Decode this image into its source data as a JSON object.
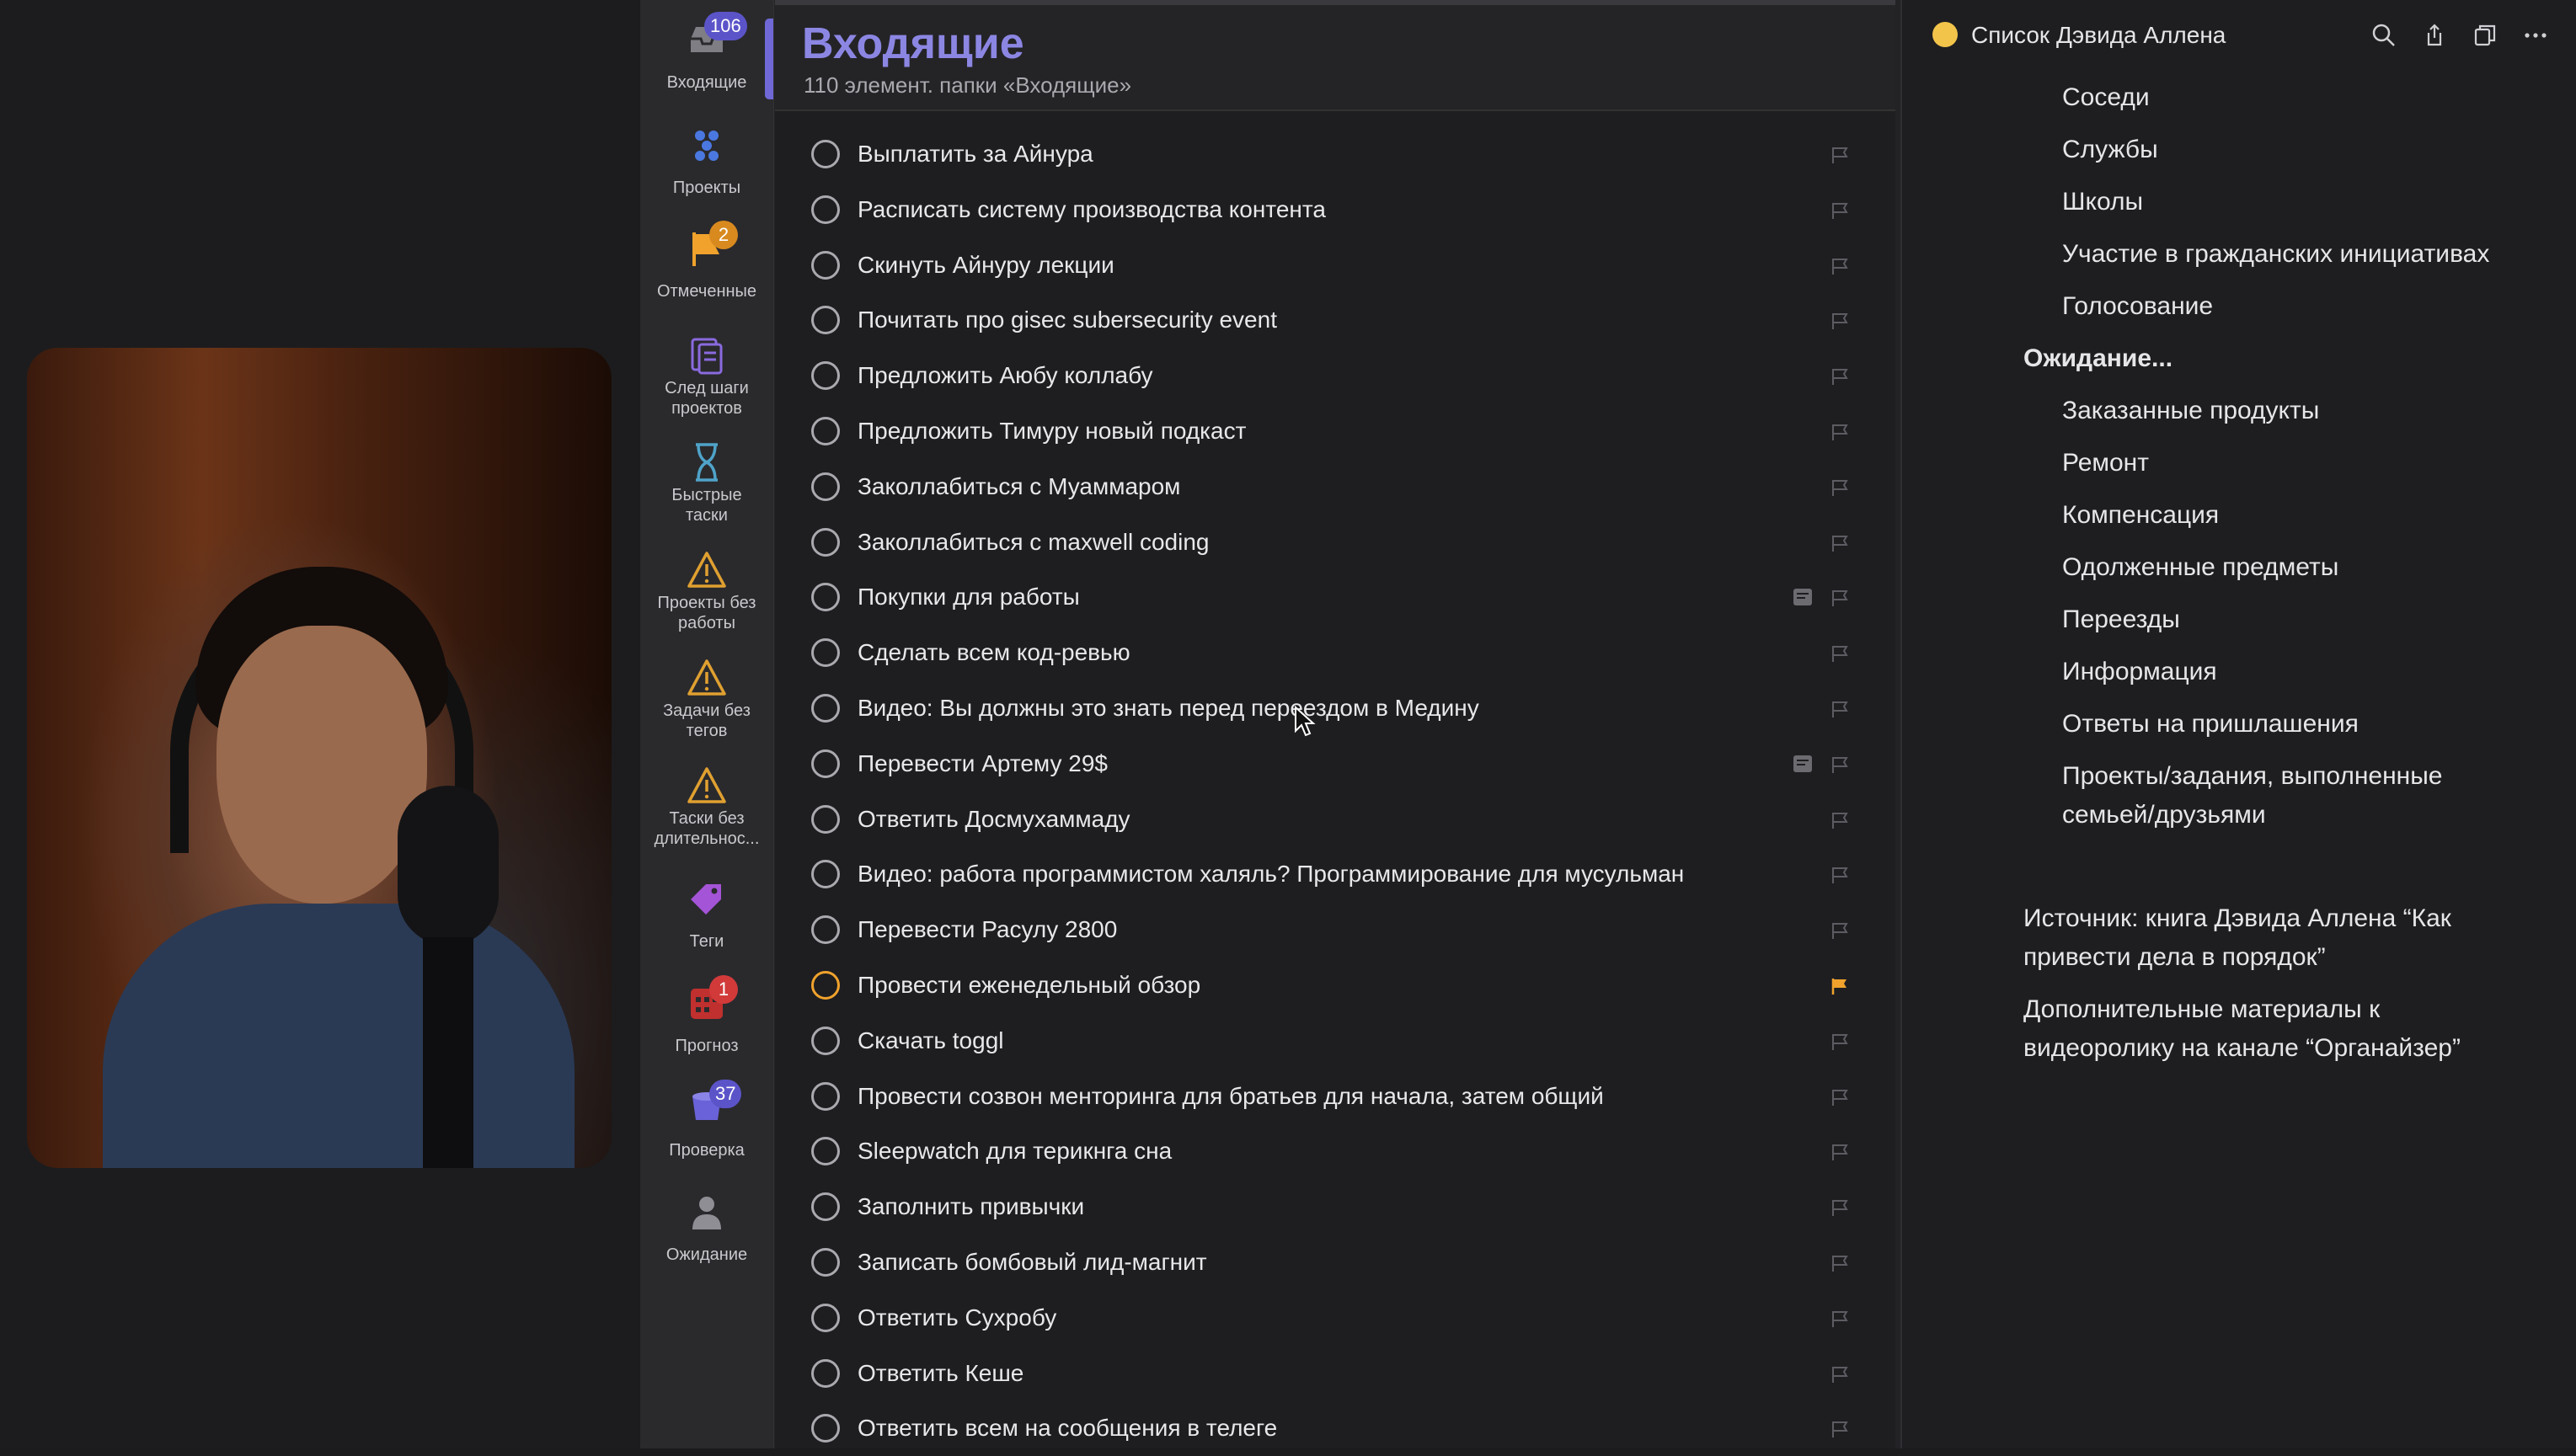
{
  "sidebar": {
    "items": [
      {
        "label": "Входящие",
        "badge": "106",
        "icon": "inbox-icon"
      },
      {
        "label": "Проекты",
        "icon": "projects-icon"
      },
      {
        "label": "Отмеченные",
        "badge": "2",
        "icon": "flag-icon"
      },
      {
        "label": "След шаги проектов",
        "icon": "next-steps-icon"
      },
      {
        "label": "Быстрые таски",
        "icon": "hourglass-icon"
      },
      {
        "label": "Проекты без работы",
        "icon": "warning-icon"
      },
      {
        "label": "Задачи без тегов",
        "icon": "warning-icon"
      },
      {
        "label": "Таски без длительнос...",
        "icon": "warning-icon"
      },
      {
        "label": "Теги",
        "icon": "tag-icon"
      },
      {
        "label": "Прогноз",
        "badge": "1",
        "icon": "calendar-icon"
      },
      {
        "label": "Проверка",
        "badge": "37",
        "icon": "review-icon"
      },
      {
        "label": "Ожидание",
        "icon": "person-icon"
      }
    ]
  },
  "main": {
    "title": "Входящие",
    "subtitle": "110 элемент. папки «Входящие»",
    "tasks": [
      {
        "text": "Выплатить за Айнура",
        "flagged": false,
        "note": false
      },
      {
        "text": "Расписать систему производства контента",
        "flagged": false,
        "note": false
      },
      {
        "text": "Скинуть Айнуру лекции",
        "flagged": false,
        "note": false
      },
      {
        "text": "Почитать про  gisec subersecurity event",
        "flagged": false,
        "note": false
      },
      {
        "text": "Предложить Аюбу коллабу",
        "flagged": false,
        "note": false
      },
      {
        "text": "Предложить Тимуру новый подкаст",
        "flagged": false,
        "note": false
      },
      {
        "text": "Заколлабиться с Муаммаром",
        "flagged": false,
        "note": false
      },
      {
        "text": "Заколлабиться с maxwell coding",
        "flagged": false,
        "note": false
      },
      {
        "text": "Покупки для работы",
        "flagged": false,
        "note": true
      },
      {
        "text": "Сделать всем код-ревью",
        "flagged": false,
        "note": false
      },
      {
        "text": "Видео: Вы должны это знать перед переездом в Медину",
        "flagged": false,
        "note": false
      },
      {
        "text": "Перевести Артему 29$",
        "flagged": false,
        "note": true
      },
      {
        "text": "Ответить Досмухаммаду",
        "flagged": false,
        "note": false
      },
      {
        "text": "Видео: работа программистом халяль? Программирование для мусульман",
        "flagged": false,
        "note": false
      },
      {
        "text": "Перевести Расулу 2800",
        "flagged": false,
        "note": false
      },
      {
        "text": "Провести еженедельный обзор",
        "flagged": true,
        "note": false
      },
      {
        "text": "Скачать toggl",
        "flagged": false,
        "note": false
      },
      {
        "text": "Провести созвон менторинга для братьев для начала, затем общий",
        "flagged": false,
        "note": false
      },
      {
        "text": "Sleepwatch для терикнга сна",
        "flagged": false,
        "note": false
      },
      {
        "text": "Заполнить привычки",
        "flagged": false,
        "note": false
      },
      {
        "text": "Записать бомбовый лид-магнит",
        "flagged": false,
        "note": false
      },
      {
        "text": "Ответить Сухробу",
        "flagged": false,
        "note": false
      },
      {
        "text": "Ответить Кеше",
        "flagged": false,
        "note": false
      },
      {
        "text": "Ответить всем на сообщения в телеге",
        "flagged": false,
        "note": false
      }
    ]
  },
  "right": {
    "title": "Список Дэвида Аллена",
    "items": [
      {
        "text": "Соседи",
        "level": 2
      },
      {
        "text": "Службы",
        "level": 2
      },
      {
        "text": "Школы",
        "level": 2
      },
      {
        "text": "Участие в гражданских инициативах",
        "level": 2
      },
      {
        "text": "Голосование",
        "level": 2
      },
      {
        "text": "Ожидание...",
        "level": 1
      },
      {
        "text": "Заказанные продукты",
        "level": 2
      },
      {
        "text": "Ремонт",
        "level": 2
      },
      {
        "text": "Компенсация",
        "level": 2
      },
      {
        "text": "Одолженные предметы",
        "level": 2
      },
      {
        "text": "Переезды",
        "level": 2
      },
      {
        "text": "Информация",
        "level": 2
      },
      {
        "text": "Ответы на пришлашения",
        "level": 2
      },
      {
        "text": "Проекты/задания, выполненные",
        "level": 2
      },
      {
        "text": "семьей/друзьями",
        "level": 2
      }
    ],
    "source_line1": "Источник: книга Дэвида Аллена “Как",
    "source_line2": "привести дела в порядок”",
    "extra_line1": "Дополнительные материалы к",
    "extra_line2": "видеоролику на канале “Органайзер”"
  },
  "colors": {
    "accent": "#8c86e3",
    "flag": "#f0a22c",
    "badge_purple": "#5b54c9",
    "badge_red": "#d23a3a"
  }
}
